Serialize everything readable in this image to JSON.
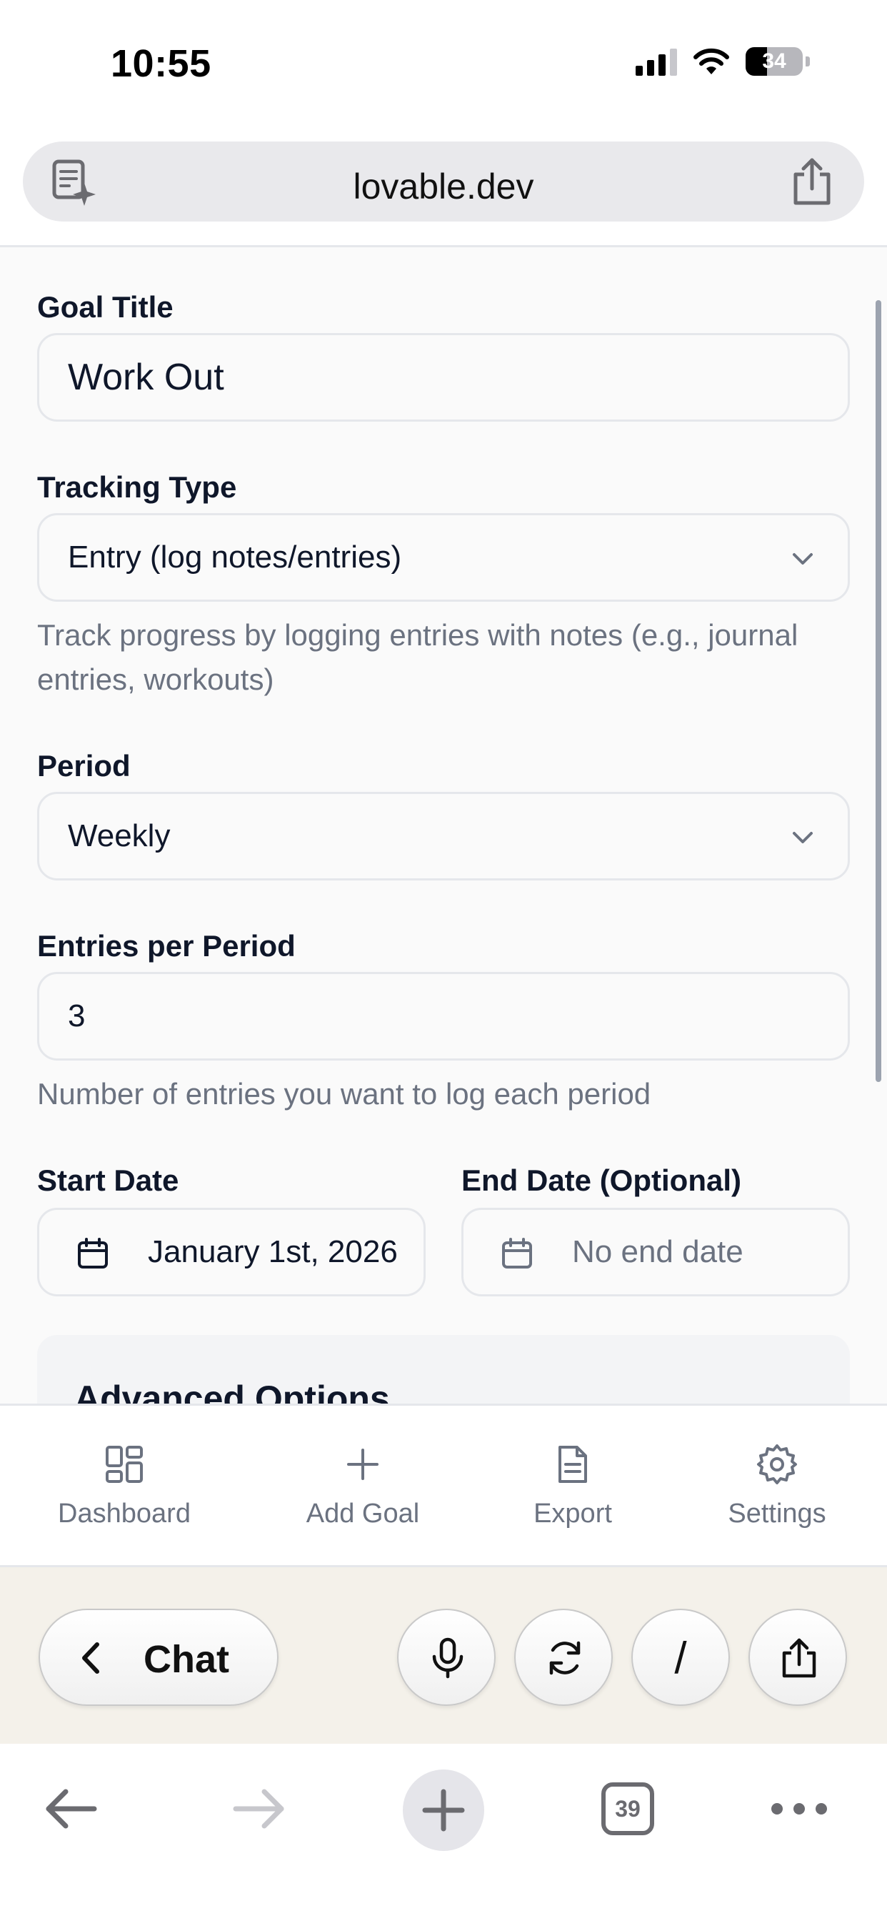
{
  "status_bar": {
    "time": "10:55",
    "battery": "34"
  },
  "browser": {
    "url": "lovable.dev",
    "tab_count": "39"
  },
  "form": {
    "goal_title": {
      "label": "Goal Title",
      "value": "Work Out"
    },
    "tracking_type": {
      "label": "Tracking Type",
      "value": "Entry (log notes/entries)",
      "help": "Track progress by logging entries with notes (e.g., journal entries, workouts)"
    },
    "period": {
      "label": "Period",
      "value": "Weekly"
    },
    "entries_per_period": {
      "label": "Entries per Period",
      "value": "3",
      "help": "Number of entries you want to log each period"
    },
    "start_date": {
      "label": "Start Date",
      "value": "January 1st, 2026"
    },
    "end_date": {
      "label": "End Date (Optional)",
      "placeholder": "No end date"
    },
    "advanced_options": {
      "title": "Advanced Options"
    }
  },
  "bottom_nav": {
    "items": [
      {
        "label": "Dashboard",
        "icon": "dashboard-grid-icon"
      },
      {
        "label": "Add Goal",
        "icon": "plus-icon"
      },
      {
        "label": "Export",
        "icon": "document-icon"
      },
      {
        "label": "Settings",
        "icon": "gear-icon"
      }
    ]
  },
  "chat_toolbar": {
    "chat_label": "Chat",
    "slash_label": "/"
  },
  "colors": {
    "background": "#fafafa",
    "border": "#e5e7eb",
    "muted_text": "#6b7280",
    "chat_bar_bg": "#f4f1ea"
  }
}
